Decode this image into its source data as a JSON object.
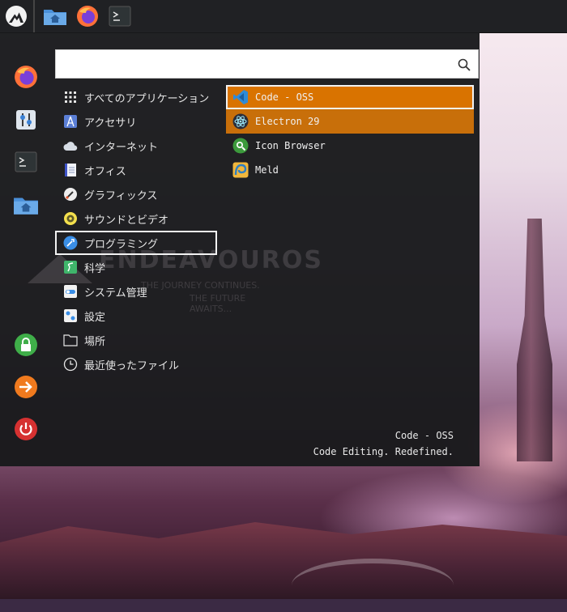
{
  "taskbar": {
    "launchers": [
      {
        "name": "Files",
        "icon": "folder-home-icon"
      },
      {
        "name": "Firefox",
        "icon": "firefox-icon"
      },
      {
        "name": "Terminal",
        "icon": "terminal-icon"
      }
    ]
  },
  "search": {
    "value": "",
    "placeholder": ""
  },
  "categories": [
    {
      "label": "すべてのアプリケーション",
      "icon": "grid-icon"
    },
    {
      "label": "アクセサリ",
      "icon": "accessories-icon"
    },
    {
      "label": "インターネット",
      "icon": "cloud-icon"
    },
    {
      "label": "オフィス",
      "icon": "document-icon"
    },
    {
      "label": "グラフィックス",
      "icon": "graphics-icon"
    },
    {
      "label": "サウンドとビデオ",
      "icon": "speaker-icon"
    },
    {
      "label": "プログラミング",
      "icon": "programming-icon",
      "active": true
    },
    {
      "label": "科学",
      "icon": "science-icon"
    },
    {
      "label": "システム管理",
      "icon": "system-settings-icon"
    },
    {
      "label": "設定",
      "icon": "settings-icon"
    },
    {
      "label": "場所",
      "icon": "folder-icon"
    },
    {
      "label": "最近使ったファイル",
      "icon": "clock-icon"
    }
  ],
  "apps": [
    {
      "label": "Code - OSS",
      "icon": "vscode-icon",
      "state": "selected"
    },
    {
      "label": "Electron 29",
      "icon": "electron-icon",
      "state": "hover"
    },
    {
      "label": "Icon Browser",
      "icon": "icon-browser-icon"
    },
    {
      "label": "Meld",
      "icon": "meld-icon"
    }
  ],
  "description": {
    "title": "Code - OSS",
    "text": "Code Editing. Redefined."
  },
  "watermark": {
    "title": "ENDEAVOUROS",
    "line1": "THE JOURNEY CONTINUES.",
    "line2": "THE FUTURE AWAITS..."
  },
  "colors": {
    "accent": "#d97300",
    "accent_hover": "#c86f0a",
    "panel": "#18191b",
    "taskbar": "#202124"
  }
}
